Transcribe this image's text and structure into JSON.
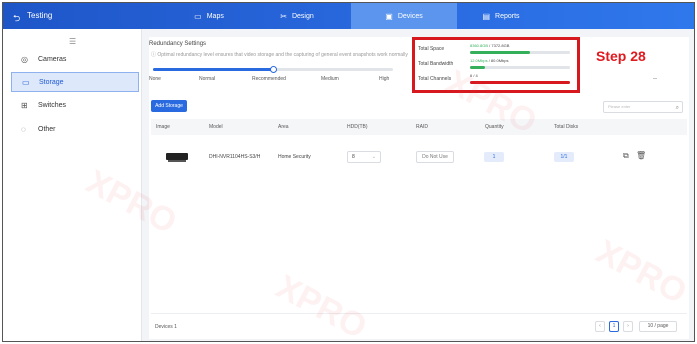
{
  "header": {
    "back_icon": "back-arrow-icon",
    "title": "Testing",
    "tabs": [
      {
        "label": "Maps",
        "icon": "map-icon",
        "active": false
      },
      {
        "label": "Design",
        "icon": "design-icon",
        "active": false
      },
      {
        "label": "Devices",
        "icon": "devices-icon",
        "active": true
      },
      {
        "label": "Reports",
        "icon": "reports-icon",
        "active": false
      }
    ]
  },
  "sidebar": {
    "items": [
      {
        "label": "Cameras",
        "icon": "camera-icon",
        "active": false
      },
      {
        "label": "Storage",
        "icon": "storage-icon",
        "active": true
      },
      {
        "label": "Switches",
        "icon": "switch-icon",
        "active": false
      },
      {
        "label": "Other",
        "icon": "other-icon",
        "active": false
      }
    ]
  },
  "redundancy": {
    "title": "Redundancy Settings",
    "description": "Optimal redundancy level ensures that video storage and the capturing of general event snapshots work normally",
    "levels": [
      "None",
      "Normal",
      "Recommended",
      "Medium",
      "High"
    ],
    "selected_fraction": 0.5
  },
  "stats": {
    "total_space_label": "Total Space",
    "total_space_used": "8360.8GB",
    "total_space_total": "/ 7372.8GB",
    "total_space_fraction": 0.6,
    "total_bandwidth_label": "Total Bandwidth",
    "total_bandwidth_used": "12.0Mbps",
    "total_bandwidth_total": "/ 80.0Mbps",
    "total_bandwidth_fraction": 0.15,
    "total_channels_label": "Total Channels",
    "total_channels_value": "6 / 4",
    "total_channels_fraction": 1.0,
    "colors": {
      "space": "#34b05a",
      "bandwidth": "#34b05a",
      "channels": "#d7191f"
    }
  },
  "annotation": {
    "step_label": "Step 28",
    "dash": "--"
  },
  "toolbar": {
    "add_label": "Add Storage",
    "search_placeholder": "Please enter",
    "search_icon": "search-icon"
  },
  "table": {
    "columns": [
      "Image",
      "Model",
      "Area",
      "HDD(TB)",
      "RAID",
      "Quantity",
      "Total Disks"
    ],
    "rows": [
      {
        "model": "DHI-NVR1104HS-S3/H",
        "area": "Home Security",
        "hdd": "8",
        "raid": "Do Not Use",
        "quantity": "1",
        "total_disks": "1/1"
      }
    ]
  },
  "footer": {
    "devices_count": "Devices 1",
    "current_page": "1",
    "page_size": "10 / page"
  },
  "watermark_text": "XPRO"
}
